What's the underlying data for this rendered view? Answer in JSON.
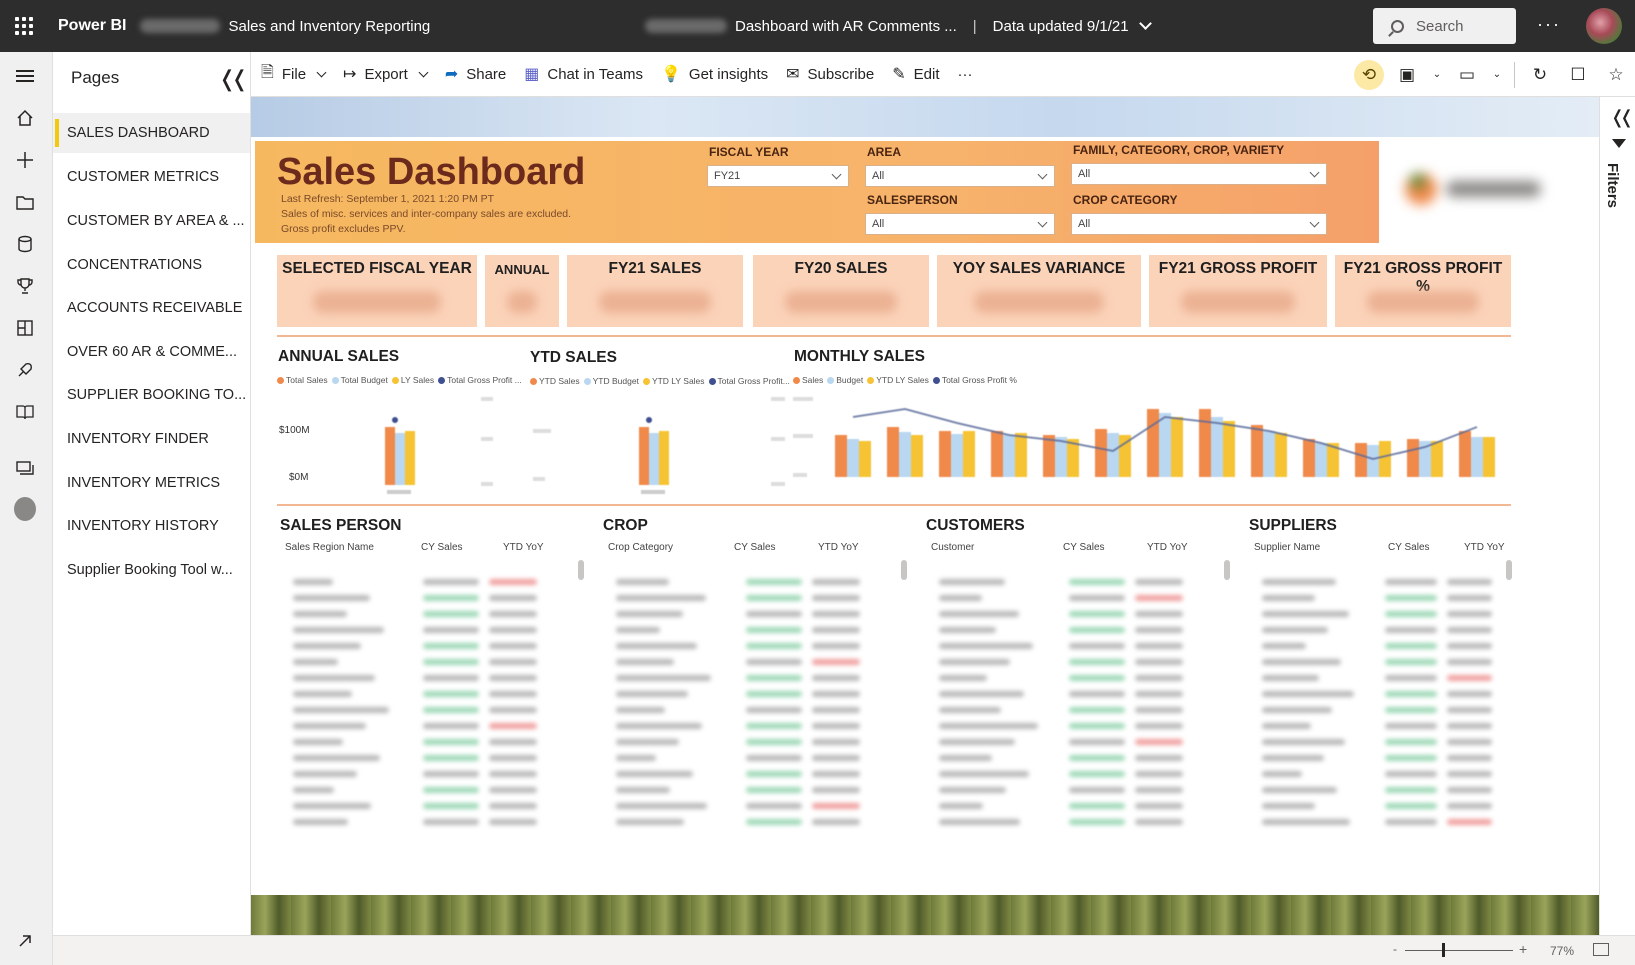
{
  "topbar": {
    "brand": "Power BI",
    "report_name": "Sales and Inventory Reporting",
    "report_title": "Dashboard with AR Comments ...",
    "data_updated": "Data updated 9/1/21",
    "search_placeholder": "Search",
    "more": "···"
  },
  "pages_pane": {
    "title": "Pages",
    "items": [
      {
        "label": "SALES DASHBOARD",
        "active": true
      },
      {
        "label": "CUSTOMER METRICS"
      },
      {
        "label": "CUSTOMER BY AREA & ..."
      },
      {
        "label": "CONCENTRATIONS"
      },
      {
        "label": "ACCOUNTS RECEIVABLE"
      },
      {
        "label": "OVER 60 AR & COMME..."
      },
      {
        "label": "SUPPLIER BOOKING TO..."
      },
      {
        "label": "INVENTORY FINDER"
      },
      {
        "label": "INVENTORY METRICS"
      },
      {
        "label": "INVENTORY HISTORY"
      },
      {
        "label": "Supplier Booking Tool w..."
      }
    ]
  },
  "actionbar": {
    "file": "File",
    "export": "Export",
    "share": "Share",
    "chat_in_teams": "Chat in Teams",
    "get_insights": "Get insights",
    "subscribe": "Subscribe",
    "edit": "Edit",
    "more": "···"
  },
  "report": {
    "title": "Sales Dashboard",
    "last_refresh": "Last Refresh: September 1, 2021 1:20 PM PT",
    "note1": "Sales of misc. services and inter-company sales are excluded.",
    "note2": "Gross profit excludes PPV.",
    "slicers": {
      "fiscal_year": {
        "label": "FISCAL YEAR",
        "value": "FY21"
      },
      "area": {
        "label": "AREA",
        "value": "All"
      },
      "salesperson": {
        "label": "SALESPERSON",
        "value": "All"
      },
      "family": {
        "label": "FAMILY, CATEGORY, CROP, VARIETY",
        "value": "All"
      },
      "crop_category": {
        "label": "CROP CATEGORY",
        "value": "All"
      }
    },
    "kpis": [
      {
        "title": "SELECTED FISCAL YEAR"
      },
      {
        "title": "ANNUAL"
      },
      {
        "title": "FY21 SALES"
      },
      {
        "title": "FY20 SALES"
      },
      {
        "title": "YOY SALES VARIANCE"
      },
      {
        "title": "FY21 GROSS PROFIT"
      },
      {
        "title": "FY21 GROSS PROFIT %"
      }
    ],
    "annual_sales": {
      "title": "ANNUAL SALES",
      "legend": [
        "Total Sales",
        "Total Budget",
        "LY Sales",
        "Total Gross Profit ..."
      ],
      "y_ticks": [
        "$100M",
        "$0M"
      ]
    },
    "ytd_sales": {
      "title": "YTD SALES",
      "legend": [
        "YTD Sales",
        "YTD Budget",
        "YTD LY Sales",
        "Total Gross Profit..."
      ]
    },
    "monthly_sales": {
      "title": "MONTHLY SALES",
      "legend": [
        "Sales",
        "Budget",
        "YTD LY Sales",
        "Total Gross Profit %"
      ]
    },
    "tables": {
      "sales_person": {
        "title": "SALES PERSON",
        "cols": [
          "Sales Region Name",
          "CY Sales",
          "YTD YoY"
        ]
      },
      "crop": {
        "title": "CROP",
        "cols": [
          "Crop Category",
          "CY Sales",
          "YTD YoY"
        ]
      },
      "customers": {
        "title": "CUSTOMERS",
        "cols": [
          "Customer",
          "CY Sales",
          "YTD YoY"
        ]
      },
      "suppliers": {
        "title": "SUPPLIERS",
        "cols": [
          "Supplier Name",
          "CY Sales",
          "YTD YoY"
        ]
      }
    }
  },
  "filters_pane": {
    "label": "Filters"
  },
  "statusbar": {
    "zoom": "77%",
    "minus": "-",
    "plus": "+"
  },
  "colors": {
    "sales": "#f08a4b",
    "budget": "#b9d7f0",
    "ly_sales": "#f5c334",
    "gross_profit": "#3f4f8f",
    "accent": "#f2c811"
  }
}
